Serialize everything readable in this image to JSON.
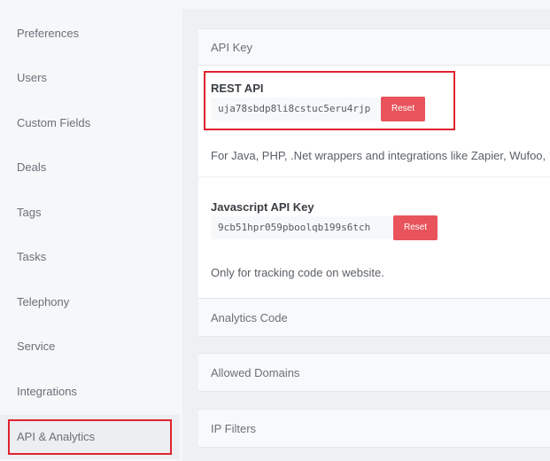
{
  "sidebar": {
    "items": [
      {
        "label": "Preferences"
      },
      {
        "label": "Users"
      },
      {
        "label": "Custom Fields"
      },
      {
        "label": "Deals"
      },
      {
        "label": "Tags"
      },
      {
        "label": "Tasks"
      },
      {
        "label": "Telephony"
      },
      {
        "label": "Service"
      },
      {
        "label": "Integrations"
      },
      {
        "label": "API & Analytics"
      }
    ],
    "active": "API & Analytics"
  },
  "main": {
    "api_key_header": "API Key",
    "rest": {
      "title": "REST API",
      "key": "uja78sbdp8li8cstuc5eru4rjp",
      "reset_label": "Reset",
      "description": "For Java, PHP, .Net wrappers and integrations like Zapier, Wufoo, I"
    },
    "js": {
      "title": "Javascript API Key",
      "key": "9cb51hpr059pboolqb199s6tch",
      "reset_label": "Reset",
      "description": "Only for tracking code on website."
    },
    "analytics_header": "Analytics Code",
    "domains_header": "Allowed Domains",
    "ip_header": "IP Filters"
  },
  "colors": {
    "highlight": "#e0232e",
    "reset_button": "#e8535c",
    "background": "#f5f7f9"
  }
}
